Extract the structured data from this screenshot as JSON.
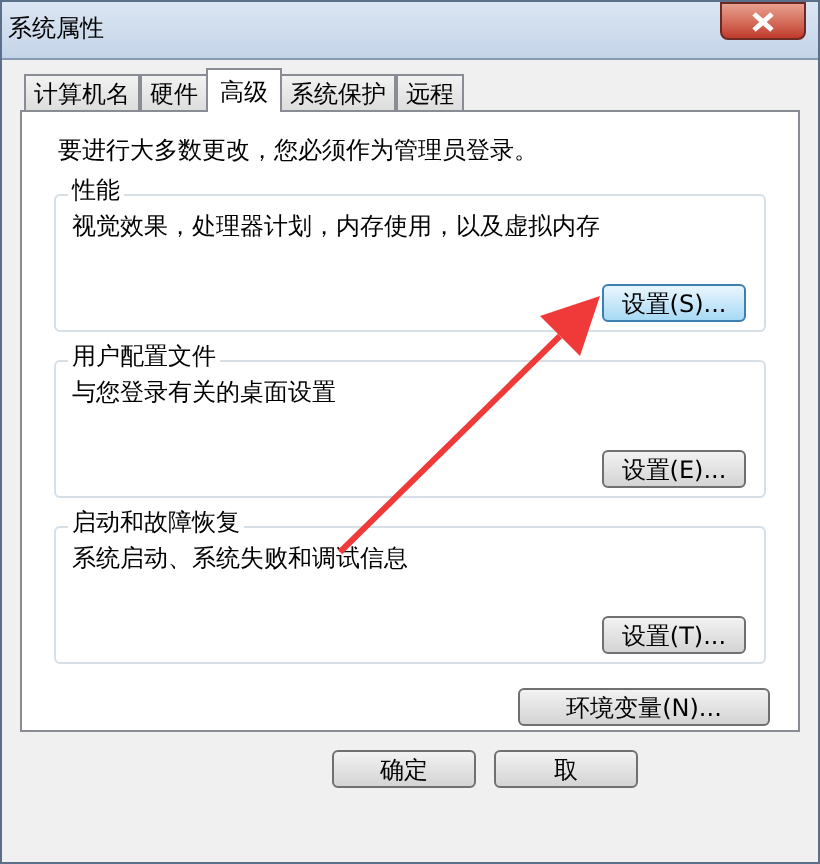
{
  "window": {
    "title": "系统属性"
  },
  "tabs": [
    {
      "label": "计算机名",
      "selected": false
    },
    {
      "label": "硬件",
      "selected": false
    },
    {
      "label": "高级",
      "selected": true
    },
    {
      "label": "系统保护",
      "selected": false
    },
    {
      "label": "远程",
      "selected": false
    }
  ],
  "notice": "要进行大多数更改，您必须作为管理员登录。",
  "groups": [
    {
      "title": "性能",
      "description": "视觉效果，处理器计划，内存使用，以及虚拟内存",
      "button": "设置(S)...",
      "focused": true
    },
    {
      "title": "用户配置文件",
      "description": "与您登录有关的桌面设置",
      "button": "设置(E)...",
      "focused": false
    },
    {
      "title": "启动和故障恢复",
      "description": "系统启动、系统失败和调试信息",
      "button": "设置(T)...",
      "focused": false
    }
  ],
  "env_button": "环境变量(N)...",
  "buttons": [
    "确定",
    "取"
  ]
}
